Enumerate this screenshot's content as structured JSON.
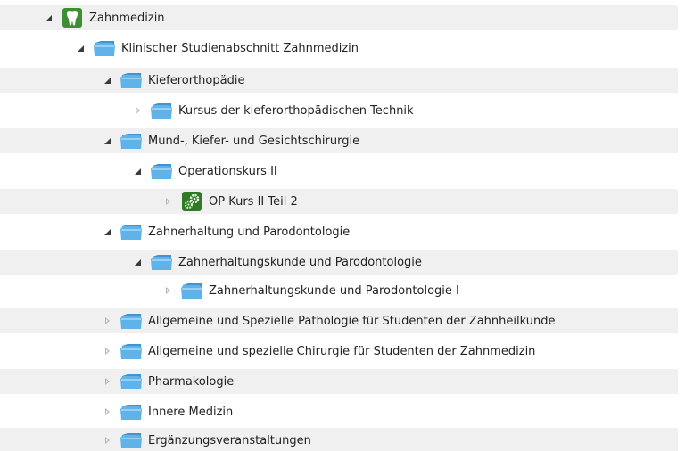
{
  "tree": {
    "items": [
      {
        "label": "Zahnmedizin",
        "icon": "tooth-icon",
        "toggle": "expanded"
      },
      {
        "label": "Klinischer Studienabschnitt Zahnmedizin",
        "icon": "folder-icon",
        "toggle": "expanded"
      },
      {
        "label": "Kieferorthopädie",
        "icon": "folder-icon",
        "toggle": "expanded"
      },
      {
        "label": "Kursus der kieferorthopädischen Technik",
        "icon": "folder-icon",
        "toggle": "collapsed"
      },
      {
        "label": "Mund-, Kiefer- und Gesichtschirurgie",
        "icon": "folder-icon",
        "toggle": "expanded"
      },
      {
        "label": "Operationskurs II",
        "icon": "folder-icon",
        "toggle": "expanded"
      },
      {
        "label": "OP Kurs II Teil 2",
        "icon": "gears-icon",
        "toggle": "collapsed"
      },
      {
        "label": "Zahnerhaltung und Parodontologie",
        "icon": "folder-icon",
        "toggle": "expanded"
      },
      {
        "label": "Zahnerhaltungskunde und Parodontologie",
        "icon": "folder-icon",
        "toggle": "expanded"
      },
      {
        "label": "Zahnerhaltungskunde und Parodontologie I",
        "icon": "folder-icon",
        "toggle": "collapsed"
      },
      {
        "label": "Allgemeine und Spezielle Pathologie für Studenten der Zahnheilkunde",
        "icon": "folder-icon",
        "toggle": "collapsed"
      },
      {
        "label": "Allgemeine und spezielle Chirurgie für Studenten der Zahnmedizin",
        "icon": "folder-icon",
        "toggle": "collapsed"
      },
      {
        "label": "Pharmakologie",
        "icon": "folder-icon",
        "toggle": "collapsed"
      },
      {
        "label": "Innere Medizin",
        "icon": "folder-icon",
        "toggle": "collapsed"
      },
      {
        "label": "Ergänzungsveranstaltungen",
        "icon": "folder-icon",
        "toggle": "collapsed"
      }
    ]
  },
  "colors": {
    "row_shade": "#f0f0f0",
    "folder_blue": "#5fb3e8",
    "tooth_green": "#3e8e33",
    "gears_green": "#2f7a25",
    "text": "#222222"
  }
}
